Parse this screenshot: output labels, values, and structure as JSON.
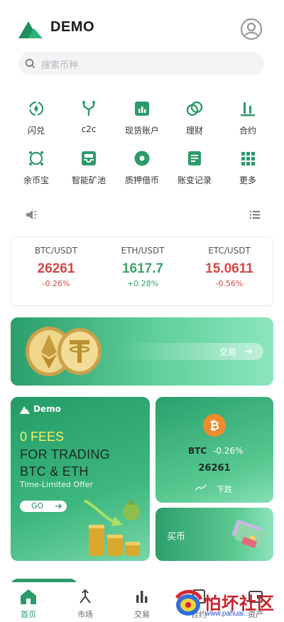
{
  "header": {
    "title": "DEMO",
    "logo_icon": "mountain-logo-icon",
    "profile_icon": "user-circle-icon"
  },
  "search": {
    "placeholder": "搜索币种"
  },
  "menu": [
    {
      "label": "闪兑",
      "icon": "swap-icon"
    },
    {
      "label": "c2c",
      "icon": "fork-icon"
    },
    {
      "label": "现货账户",
      "icon": "bar-chart-icon"
    },
    {
      "label": "理财",
      "icon": "rings-icon"
    },
    {
      "label": "合约",
      "icon": "candles-icon"
    },
    {
      "label": "余币宝",
      "icon": "target-icon"
    },
    {
      "label": "智能矿池",
      "icon": "tray-icon"
    },
    {
      "label": "质押借币",
      "icon": "disc-icon"
    },
    {
      "label": "账变记录",
      "icon": "document-icon"
    },
    {
      "label": "更多",
      "icon": "grid-icon"
    }
  ],
  "notice": {
    "icon": "speaker-icon",
    "list_icon": "list-icon"
  },
  "tickers": [
    {
      "pair": "BTC/USDT",
      "price": "26261",
      "change": "-0.26%",
      "direction": "down"
    },
    {
      "pair": "ETH/USDT",
      "price": "1617.7",
      "change": "+0.28%",
      "direction": "up"
    },
    {
      "pair": "ETC/USDT",
      "price": "15.0611",
      "change": "-0.56%",
      "direction": "down"
    }
  ],
  "banner": {
    "button_label": "交易"
  },
  "promo": {
    "brand": "Demo",
    "fees": "0 FEES",
    "line1": "FOR TRADING",
    "line2": "BTC & ETH",
    "offer": "Time-Limited Offer",
    "go_label": "GO"
  },
  "btc_card": {
    "symbol": "BTC",
    "change": "-0.26%",
    "price": "26261",
    "trend_label": "下跌"
  },
  "buy_card": {
    "label": "买币"
  },
  "bottom_nav": [
    {
      "label": "首页",
      "icon": "home-icon",
      "active": true
    },
    {
      "label": "市场",
      "icon": "market-icon",
      "active": false
    },
    {
      "label": "交易",
      "icon": "trade-bars-icon",
      "active": false
    },
    {
      "label": "合约",
      "icon": "contract-icon",
      "active": false
    },
    {
      "label": "资产",
      "icon": "wallet-icon",
      "active": false
    }
  ],
  "watermark": {
    "text": "怕坏社区",
    "url": "www.pahuai..."
  },
  "colors": {
    "brand_green": "#2c9b69",
    "down_red": "#d14848",
    "up_green": "#3aa46b",
    "fees_yellow": "#f5ee6a"
  }
}
